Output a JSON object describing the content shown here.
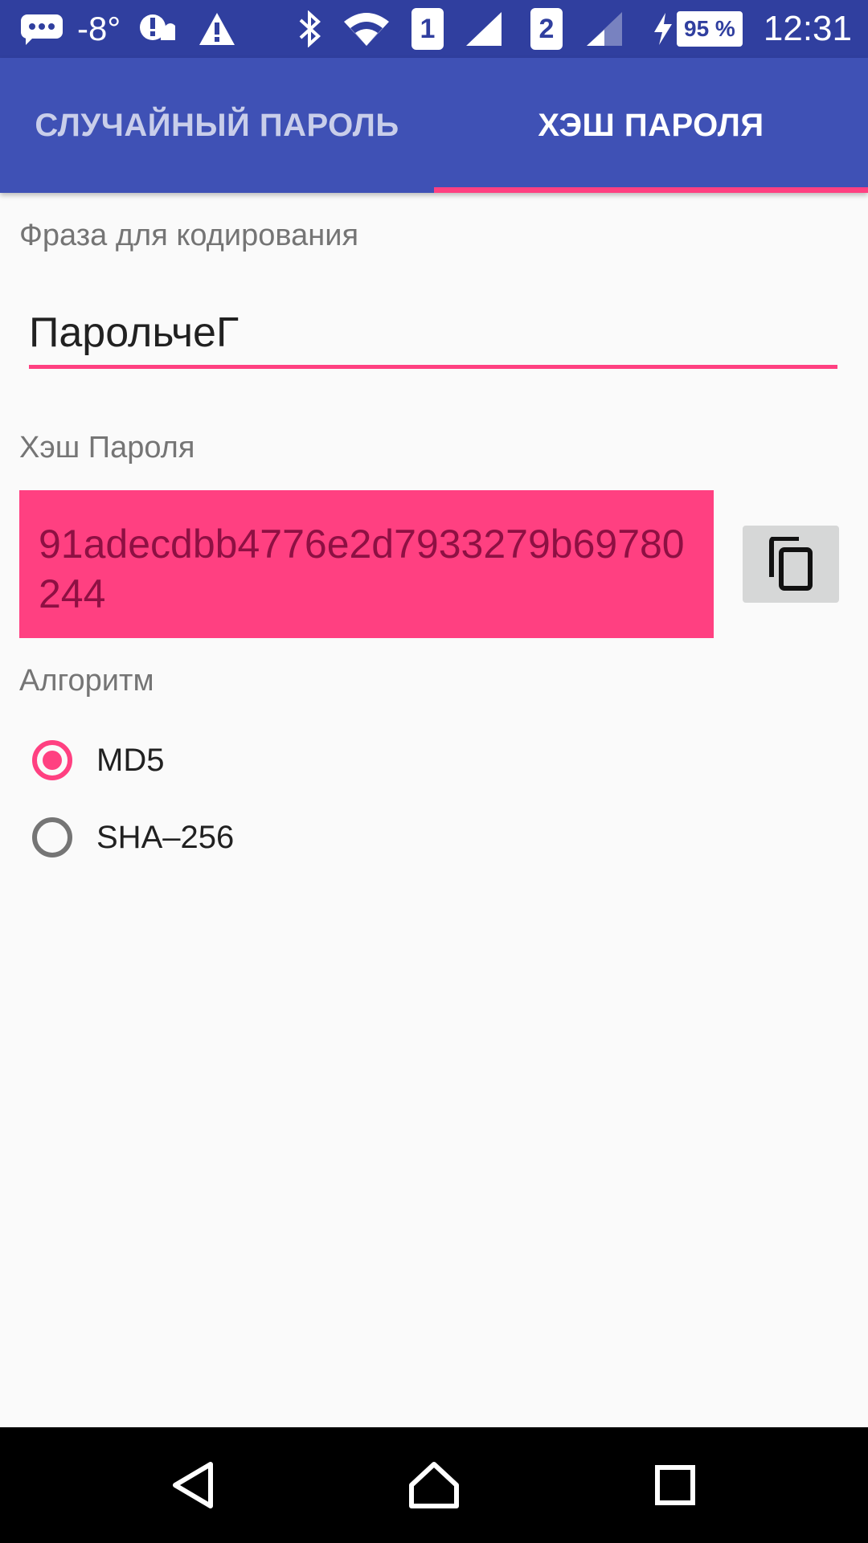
{
  "status_bar": {
    "temperature": "-8°",
    "sim1": "1",
    "sim2": "2",
    "battery": "95 %",
    "time": "12:31",
    "icons": [
      "message-icon",
      "weather-alert-icon",
      "warning-icon",
      "bluetooth-icon",
      "wifi-icon",
      "signal-icon",
      "signal-icon",
      "charging-icon",
      "battery-icon"
    ]
  },
  "tabs": [
    {
      "label": "СЛУЧАЙНЫЙ ПАРОЛЬ",
      "selected": false
    },
    {
      "label": "ХЭШ ПАРОЛЯ",
      "selected": true
    }
  ],
  "form": {
    "phrase_label": "Фраза для кодирования",
    "phrase_value": "ПарольчеГ",
    "hash_label": "Хэш Пароля",
    "hash_value": "91adecdbb4776e2d7933279b69780244",
    "algorithm_label": "Алгоритм",
    "algorithms": [
      {
        "label": "MD5",
        "checked": true
      },
      {
        "label": "SHA–256",
        "checked": false
      }
    ]
  },
  "colors": {
    "primary": "#3F51B5",
    "primary_dark": "#303F9F",
    "accent": "#FF4081"
  }
}
